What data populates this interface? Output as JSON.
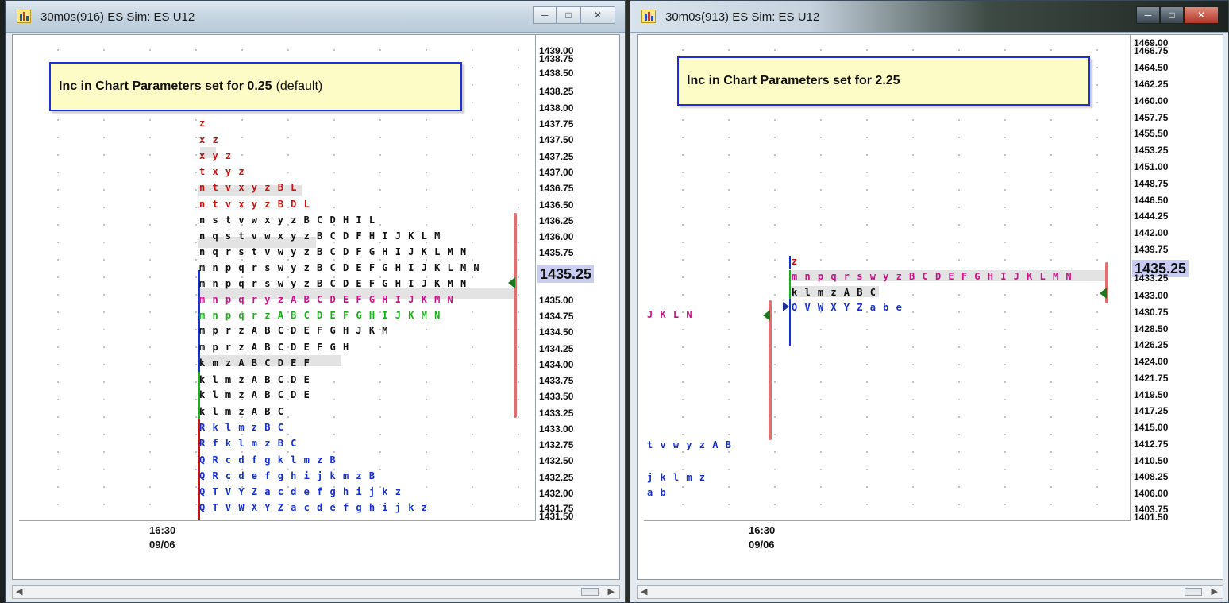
{
  "colors": {
    "red": "#cc1111",
    "black": "#111111",
    "magenta": "#d0108a",
    "green": "#19b019",
    "blue": "#1530d0",
    "note_border": "#1d2fd8",
    "note_bg": "#fdfbc6",
    "current_price_bg": "#c9cdf2"
  },
  "windows": [
    {
      "title": "30m0s(916) ES Sim: ES U12",
      "note": {
        "label": "Inc in Chart Parameters set for 0.25",
        "suffix": "(default)"
      },
      "price_ticks": [
        "1439.00",
        "1438.75",
        "1438.50",
        "1438.25",
        "1438.00",
        "1437.75",
        "1437.50",
        "1437.25",
        "1437.00",
        "1436.75",
        "1436.50",
        "1436.25",
        "1436.00",
        "1435.75",
        "1435.00",
        "1434.75",
        "1434.50",
        "1434.25",
        "1434.00",
        "1433.75",
        "1433.50",
        "1433.25",
        "1433.00",
        "1432.75",
        "1432.50",
        "1432.25",
        "1432.00",
        "1431.75",
        "1431.50",
        "1435.25"
      ],
      "current_price": "1435.25",
      "time_label": "16:30",
      "date_label": "09/06",
      "tpo_rows": [
        "z",
        "x z",
        "x y z",
        "t x y z",
        "n t v x y z B L",
        "n t v x y z B D L",
        "n s t v w x y z B C D H I L",
        "n q s t v w x y z B C D F H I J K L M",
        "n q r s t v w y z B C D F G H I J K L M N",
        "m n p q r s w y z B C D E F G H I J K L M N",
        "m n p q r s w y z B C D E F G H I J K M N",
        "m n p q r y z A B C D E F G H I J K M N",
        "m n p q r z A B C D E F G H I J K M N",
        "m p r z A B C D E F G H J K M",
        "m p r z A B C D E F G H",
        "k m z A B C D E F",
        "k l m z A B C D E",
        "k l m z A B C D E",
        "k l m z A B C",
        "R k l m z B C",
        "R f k l m z B C",
        "Q R c d f g k l m z B",
        "Q R c d e f g h i j k m z B",
        "Q T V Y Z a c d e f g h i j k z",
        "Q T V W X Y Z a c d e f g h i j k z"
      ]
    },
    {
      "title": "30m0s(913) ES Sim: ES U12",
      "note": {
        "label": "Inc in Chart Parameters set for 2.25"
      },
      "price_ticks": [
        "1469.00",
        "1466.75",
        "1464.50",
        "1462.25",
        "1460.00",
        "1457.75",
        "1455.50",
        "1453.25",
        "1451.00",
        "1448.75",
        "1446.50",
        "1444.25",
        "1442.00",
        "1439.75",
        "1433.25",
        "1433.00",
        "1430.75",
        "1428.50",
        "1426.25",
        "1424.00",
        "1421.75",
        "1419.50",
        "1417.25",
        "1415.00",
        "1412.75",
        "1410.50",
        "1408.25",
        "1406.00",
        "1403.75",
        "1401.50"
      ],
      "current_price": "1435.25",
      "time_label": "16:30",
      "date_label": "09/06",
      "tpo_rows": [
        "z",
        "m n p q r s w y z B C D E F G H I J K L M N",
        "k l m z A B C",
        "Q V W X Y Z a b e",
        "J K L N",
        "t v w y z A B",
        "j k l m z",
        "a b"
      ]
    }
  ]
}
